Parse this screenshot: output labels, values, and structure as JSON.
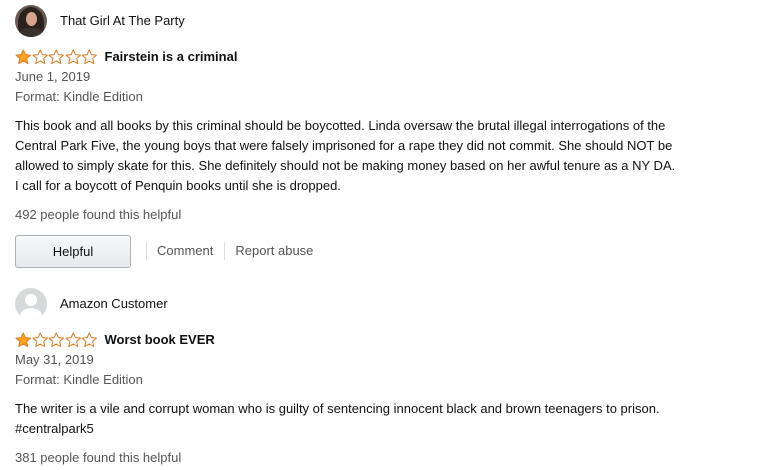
{
  "reviews": [
    {
      "profile_name": "That Girl At The Party",
      "avatar_type": "photo",
      "rating": 1,
      "rating_max": 5,
      "title": "Fairstein is a criminal",
      "date": "June 1, 2019",
      "format": "Format: Kindle Edition",
      "body_lines": [
        "This book and all books by this criminal should be boycotted. Linda oversaw the brutal illegal interrogations of the",
        "Central Park Five, the young boys that were falsely imprisoned for a rape they did not commit. She should NOT be",
        "allowed to simply skate for this. She definitely should not be making money based on her awful tenure as a NY DA.",
        "I call for a boycott of Penquin books until she is dropped."
      ],
      "helpful_text": "492 people found this helpful",
      "helpful_button": "Helpful",
      "comment_link": "Comment",
      "report_link": "Report abuse"
    },
    {
      "profile_name": "Amazon Customer",
      "avatar_type": "default",
      "rating": 1,
      "rating_max": 5,
      "title": "Worst book EVER",
      "date": "May 31, 2019",
      "format": "Format: Kindle Edition",
      "body_lines": [
        "The writer is a vile and corrupt woman who is guilty of sentencing innocent black and brown teenagers to prison.",
        "#centralpark5"
      ],
      "helpful_text": "381 people found this helpful"
    }
  ],
  "colors": {
    "star_fill": "#ffa41c",
    "star_stroke": "#de7921",
    "star_empty": "#ffffff",
    "muted_text": "#555555"
  },
  "icons": {
    "star_filled": "star-filled-icon",
    "star_empty": "star-empty-icon",
    "avatar_default": "default-avatar-icon"
  }
}
